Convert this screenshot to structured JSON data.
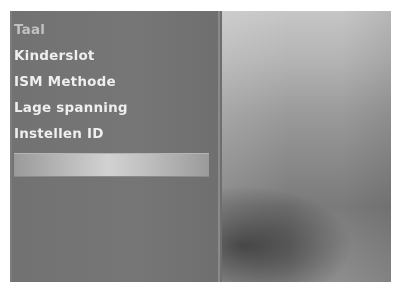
{
  "menu": {
    "items": [
      {
        "label": "Taal"
      },
      {
        "label": "Kinderslot"
      },
      {
        "label": "ISM Methode"
      },
      {
        "label": "Lage spanning"
      },
      {
        "label": "Instellen ID"
      },
      {
        "label": ""
      }
    ],
    "selected_index": 5
  },
  "colors": {
    "menu_background": "#747474",
    "menu_text": "#efefef",
    "menu_text_dim": "#c2c2c2",
    "highlight": "#c8c8c8"
  }
}
